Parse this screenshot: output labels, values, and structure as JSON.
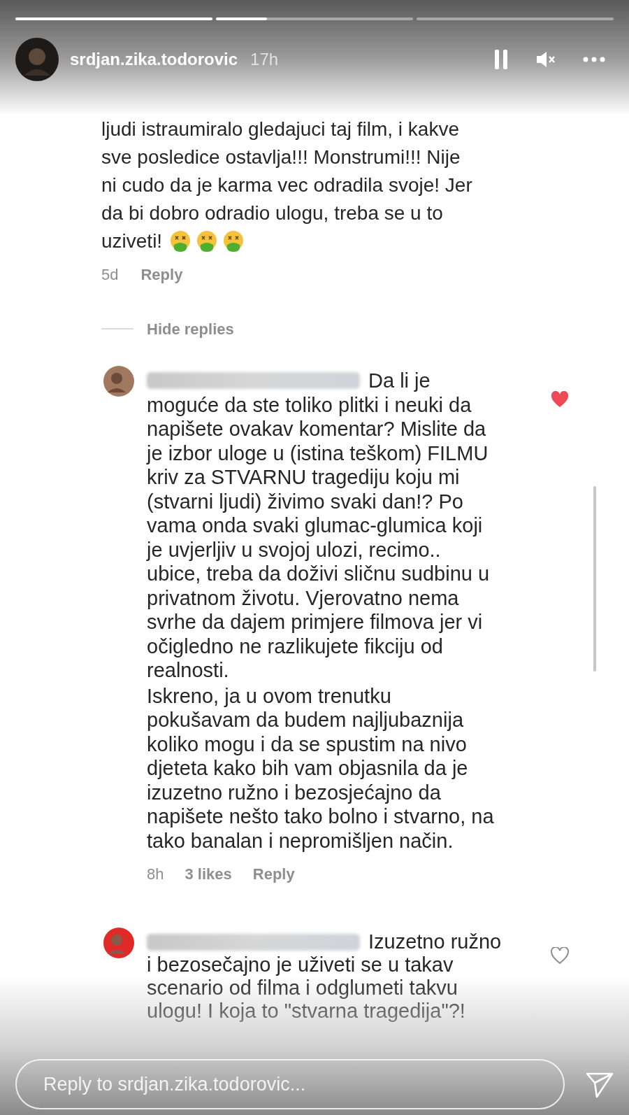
{
  "progress_bars": [
    {
      "level": 1
    },
    {
      "level": 0.26
    },
    {
      "level": 0
    }
  ],
  "header": {
    "username": "srdjan.zika.todorovic",
    "time": "17h"
  },
  "comment": {
    "lines": [
      "ljudi istraumiralo gledajuci taj film, i kakve",
      "sve posledice ostavlja!!! Monstrumi!!! Nije",
      "ni cudo da je karma vec odradila svoje! Jer",
      "da bi dobro odradio ulogu, treba se u to",
      "uziveti!"
    ],
    "time": "5d",
    "reply_label": "Reply"
  },
  "hide_replies": "Hide replies",
  "replies": [
    {
      "liked": true,
      "paragraphs": [
        [
          "Da li je",
          "moguće da ste toliko plitki i neuki da",
          "napišete ovakav komentar? Mislite da",
          "je izbor uloge u (istina teškom) FILMU",
          "kriv za STVARNU tragediju koju mi",
          "(stvarni ljudi) živimo svaki dan!? Po",
          "vama onda svaki glumac-glumica koji",
          "je uvjerljiv u svojoj ulozi, recimo..",
          "ubice, treba da doživi sličnu sudbinu u",
          "privatnom životu. Vjerovatno nema",
          "svrhe da dajem primjere filmova jer vi",
          "očigledno ne razlikujete fikciju od",
          "realnosti."
        ],
        [
          "Iskreno, ja u ovom trenutku",
          "pokušavam da budem najljubaznija",
          "koliko mogu i da se spustim na nivo",
          "djeteta kako bih vam objasnila da je",
          "izuzetno ružno i bezosjećajno da",
          "napišete nešto tako bolno i stvarno, na",
          "tako banalan i nepromišljen način."
        ]
      ],
      "time": "8h",
      "likes": "3 likes",
      "reply_label": "Reply"
    },
    {
      "liked": false,
      "paragraphs": [
        [
          "Izuzetno ružno",
          "i bezosečajno je uživeti se u takav",
          "scenario od filma i odglumeti takvu",
          "ulogu! I koja to \"stvarna tragedija\"?!"
        ]
      ]
    }
  ],
  "reply_field": {
    "placeholder": "Reply to srdjan.zika.todorovic..."
  }
}
